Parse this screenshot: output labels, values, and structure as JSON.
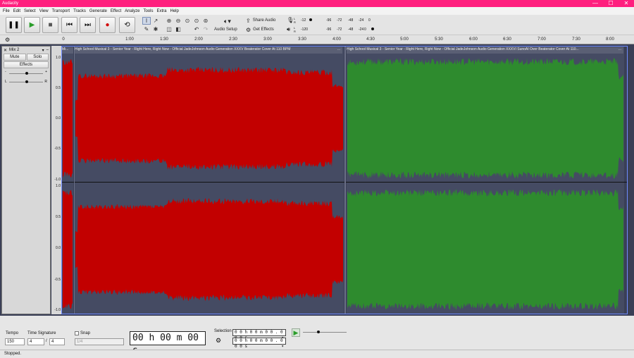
{
  "window": {
    "title": "Audacity",
    "minimize": "—",
    "maximize": "☐",
    "close": "✕"
  },
  "menu": [
    "File",
    "Edit",
    "Select",
    "View",
    "Transport",
    "Tracks",
    "Generate",
    "Effect",
    "Analyze",
    "Tools",
    "Extra",
    "Help"
  ],
  "toolbar": {
    "audio_setup": "Audio Setup",
    "share_audio": "Share Audio",
    "get_effects": "Get Effects",
    "rec_meter_ticks": [
      "-12",
      "-96",
      "-72",
      "-48",
      "-24",
      "0"
    ],
    "play_meter_ticks": [
      "-120",
      "-96",
      "-72",
      "-48",
      "-24",
      "0"
    ],
    "meter_channels": {
      "left": "L",
      "right": "R"
    }
  },
  "ruler": {
    "ticks": [
      "0",
      "1:00",
      "1:30",
      "2:00",
      "2:30",
      "3:00",
      "3:30",
      "4:00",
      "4:30",
      "5:00",
      "5:30",
      "6:00",
      "6:30",
      "7:00",
      "7:30",
      "8:00"
    ]
  },
  "track": {
    "name": "Mix 2",
    "mute": "Mute",
    "solo": "Solo",
    "effects": "Effects",
    "gain_minus": "-",
    "gain_plus": "+",
    "pan_left": "L",
    "pan_right": "R",
    "scale": [
      "1.0",
      "0.5",
      "0.0",
      "-0.5",
      "-1.0",
      "1.0",
      "0.5",
      "0.0",
      "-0.5",
      "-1.0"
    ]
  },
  "clips": [
    {
      "short": "Mi...",
      "menu": "...",
      "color": "#c20000"
    },
    {
      "title": "High School Musical 3 - Senior Year - Right Here, Right Now - Official JadeJohnson Audio Generation XXXV Beaterator Cover At 110 BPM",
      "menu": "...",
      "color": "#c20000"
    },
    {
      "title": "High School Musical 3 - Senior Year - Right Here, Right Now - Official JadeJohnson Audio Generation XXXVI SunoAI Over Beaterator Cover At 110...",
      "menu": "...",
      "color": "#2e8b2e"
    }
  ],
  "bottom": {
    "tempo_label": "Tempo",
    "tempo_value": "150",
    "timesig_label": "Time Signature",
    "timesig_num": "4",
    "timesig_den": "4",
    "snap_label": "Snap",
    "snap_value": "1/4",
    "time": "00 h 00 m 00 s",
    "selection_label": "Selection",
    "sel_start": "0 0 h 0 0 m 0 0 . 0 0 0 s",
    "sel_end": "0 0 h 0 0 m 0 0 . 0 0 0 s"
  },
  "status": "Stopped."
}
